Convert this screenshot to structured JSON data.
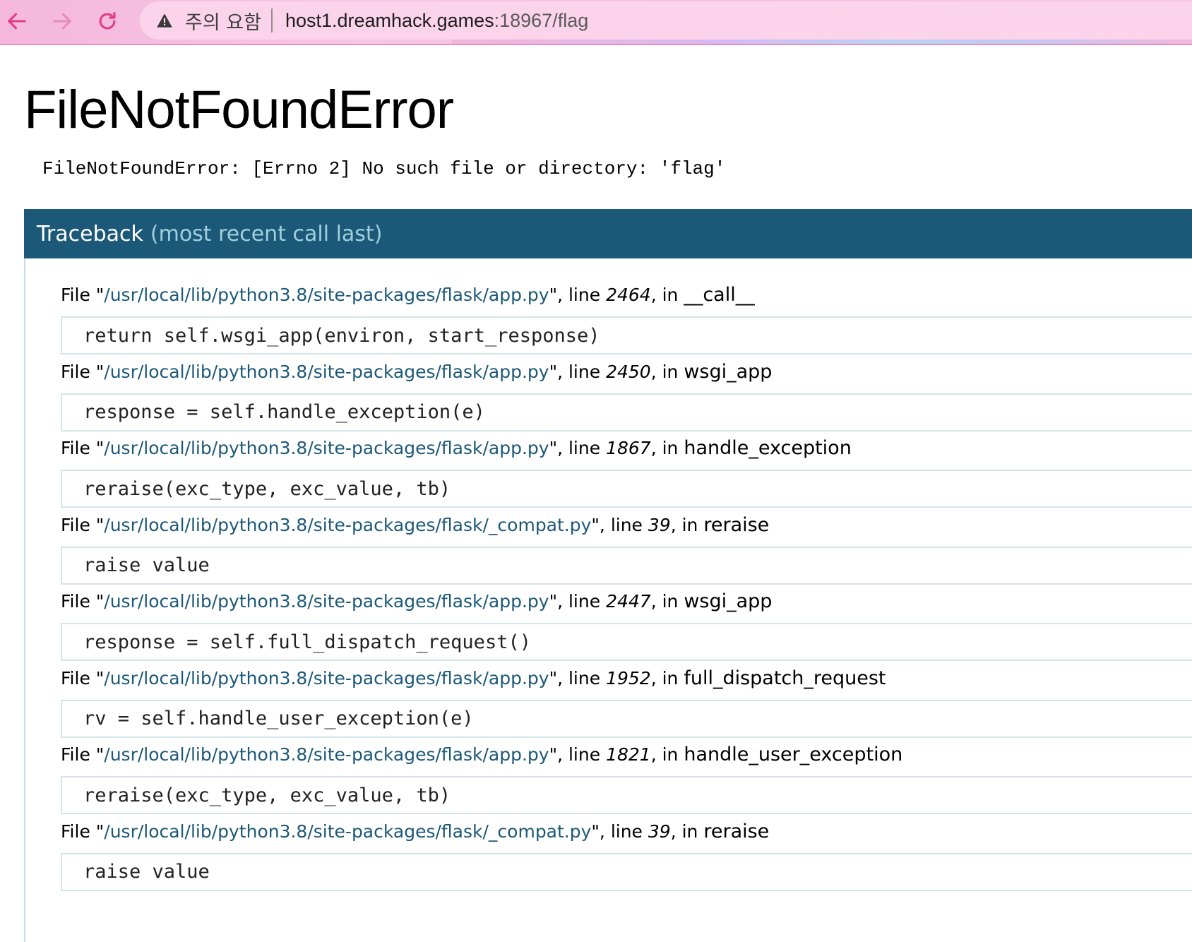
{
  "browser": {
    "security_label": "주의 요함",
    "url_host": "host1.dreamhack.games",
    "url_rest": ":18967/flag",
    "back_icon": "arrow-left-icon",
    "forward_icon": "arrow-right-icon",
    "reload_icon": "reload-icon",
    "accent": "#e23e8a"
  },
  "page": {
    "title": "FileNotFoundError",
    "error_message": "FileNotFoundError: [Errno 2] No such file or directory: 'flag'"
  },
  "traceback": {
    "header_main": "Traceback",
    "header_note": "(most recent call last)",
    "frames": [
      {
        "file": "/usr/local/lib/python3.8/site-packages/flask/app.py",
        "line": "2464",
        "func": "__call__",
        "code": "return self.wsgi_app(environ, start_response)"
      },
      {
        "file": "/usr/local/lib/python3.8/site-packages/flask/app.py",
        "line": "2450",
        "func": "wsgi_app",
        "code": "response = self.handle_exception(e)"
      },
      {
        "file": "/usr/local/lib/python3.8/site-packages/flask/app.py",
        "line": "1867",
        "func": "handle_exception",
        "code": "reraise(exc_type, exc_value, tb)"
      },
      {
        "file": "/usr/local/lib/python3.8/site-packages/flask/_compat.py",
        "line": "39",
        "func": "reraise",
        "code": "raise value"
      },
      {
        "file": "/usr/local/lib/python3.8/site-packages/flask/app.py",
        "line": "2447",
        "func": "wsgi_app",
        "code": "response = self.full_dispatch_request()"
      },
      {
        "file": "/usr/local/lib/python3.8/site-packages/flask/app.py",
        "line": "1952",
        "func": "full_dispatch_request",
        "code": "rv = self.handle_user_exception(e)"
      },
      {
        "file": "/usr/local/lib/python3.8/site-packages/flask/app.py",
        "line": "1821",
        "func": "handle_user_exception",
        "code": "reraise(exc_type, exc_value, tb)"
      },
      {
        "file": "/usr/local/lib/python3.8/site-packages/flask/_compat.py",
        "line": "39",
        "func": "reraise",
        "code": "raise value"
      }
    ]
  }
}
